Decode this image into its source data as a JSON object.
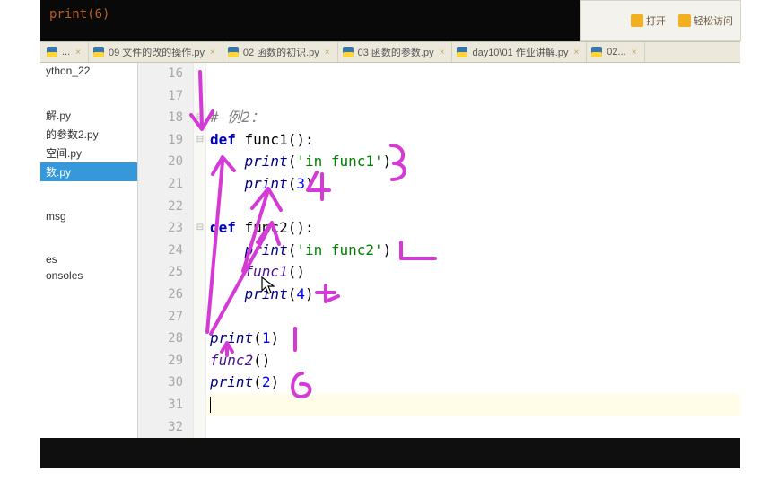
{
  "header": {
    "overlay_text": "print(6)",
    "quick_access_items": [
      {
        "label": "打开"
      },
      {
        "label": "轻松访问"
      }
    ]
  },
  "tabs": [
    {
      "label": "...",
      "icon": "py"
    },
    {
      "label": "09 文件的改的操作.py",
      "icon": "py"
    },
    {
      "label": "02 函数的初识.py",
      "icon": "py"
    },
    {
      "label": "03 函数的参数.py",
      "icon": "py"
    },
    {
      "label": "day10\\01 作业讲解.py",
      "icon": "py"
    },
    {
      "label": "02...",
      "icon": "py"
    }
  ],
  "sidebar": {
    "top_item": "ython_22",
    "group1": [
      "解.py",
      "的参数2.py",
      "空间.py",
      "数.py"
    ],
    "group2": [
      "msg"
    ],
    "group3": [
      "es",
      "onsoles"
    ]
  },
  "editor": {
    "lines": [
      {
        "n": 16,
        "tokens": []
      },
      {
        "n": 17,
        "tokens": []
      },
      {
        "n": 18,
        "fold": "-",
        "tokens": [
          {
            "t": "cmt",
            "v": "# 例2："
          }
        ]
      },
      {
        "n": 19,
        "fold": "-",
        "tokens": [
          {
            "t": "kw",
            "v": "def "
          },
          {
            "t": "fn",
            "v": "func1"
          },
          {
            "t": "",
            "v": "():"
          }
        ]
      },
      {
        "n": 20,
        "tokens": [
          {
            "t": "",
            "v": "    "
          },
          {
            "t": "call",
            "v": "print"
          },
          {
            "t": "",
            "v": "("
          },
          {
            "t": "str",
            "v": "'in func1'"
          },
          {
            "t": "",
            "v": ")"
          }
        ]
      },
      {
        "n": 21,
        "tokens": [
          {
            "t": "",
            "v": "    "
          },
          {
            "t": "call",
            "v": "print"
          },
          {
            "t": "",
            "v": "("
          },
          {
            "t": "num",
            "v": "3"
          },
          {
            "t": "",
            "v": ")"
          }
        ]
      },
      {
        "n": 22,
        "tokens": []
      },
      {
        "n": 23,
        "fold": "-",
        "tokens": [
          {
            "t": "kw",
            "v": "def "
          },
          {
            "t": "fn",
            "v": "func2"
          },
          {
            "t": "",
            "v": "():"
          }
        ]
      },
      {
        "n": 24,
        "tokens": [
          {
            "t": "",
            "v": "    "
          },
          {
            "t": "call",
            "v": "print"
          },
          {
            "t": "",
            "v": "("
          },
          {
            "t": "str",
            "v": "'in func2'"
          },
          {
            "t": "",
            "v": ")"
          }
        ]
      },
      {
        "n": 25,
        "tokens": [
          {
            "t": "",
            "v": "    "
          },
          {
            "t": "nm",
            "v": "func1"
          },
          {
            "t": "",
            "v": "()"
          }
        ]
      },
      {
        "n": 26,
        "tokens": [
          {
            "t": "",
            "v": "    "
          },
          {
            "t": "call",
            "v": "print"
          },
          {
            "t": "",
            "v": "("
          },
          {
            "t": "num",
            "v": "4"
          },
          {
            "t": "",
            "v": ")"
          }
        ]
      },
      {
        "n": 27,
        "tokens": []
      },
      {
        "n": 28,
        "tokens": [
          {
            "t": "call",
            "v": "print"
          },
          {
            "t": "",
            "v": "("
          },
          {
            "t": "num",
            "v": "1"
          },
          {
            "t": "",
            "v": ")"
          }
        ]
      },
      {
        "n": 29,
        "tokens": [
          {
            "t": "nm",
            "v": "func2"
          },
          {
            "t": "",
            "v": "()"
          }
        ]
      },
      {
        "n": 30,
        "tokens": [
          {
            "t": "call",
            "v": "print"
          },
          {
            "t": "",
            "v": "("
          },
          {
            "t": "num",
            "v": "2"
          },
          {
            "t": "",
            "v": ")"
          }
        ]
      },
      {
        "n": 31,
        "tokens": []
      },
      {
        "n": 32,
        "tokens": []
      }
    ],
    "current_line": 31
  },
  "annotations_color": "#d63ad6"
}
